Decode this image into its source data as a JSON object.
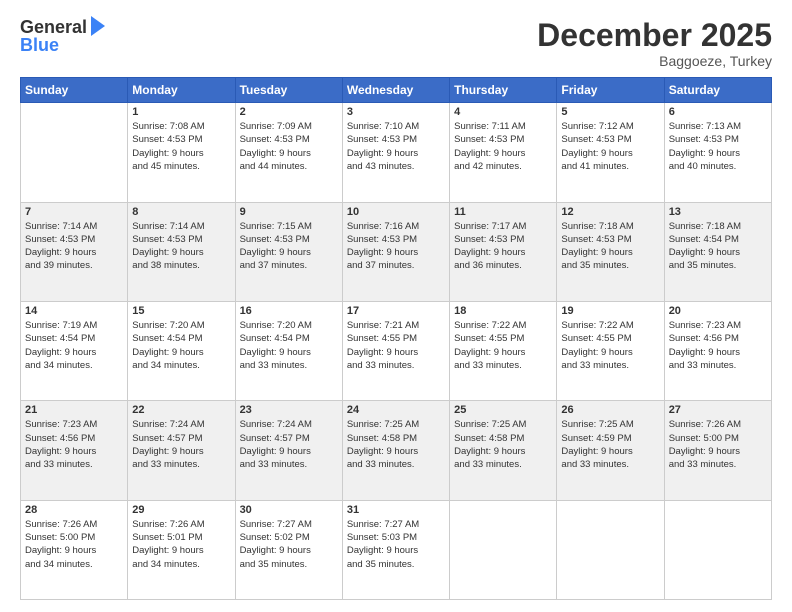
{
  "logo": {
    "general": "General",
    "blue": "Blue"
  },
  "title": "December 2025",
  "subtitle": "Baggoeze, Turkey",
  "days": [
    "Sunday",
    "Monday",
    "Tuesday",
    "Wednesday",
    "Thursday",
    "Friday",
    "Saturday"
  ],
  "rows": [
    [
      {
        "num": "",
        "lines": []
      },
      {
        "num": "1",
        "lines": [
          "Sunrise: 7:08 AM",
          "Sunset: 4:53 PM",
          "Daylight: 9 hours",
          "and 45 minutes."
        ]
      },
      {
        "num": "2",
        "lines": [
          "Sunrise: 7:09 AM",
          "Sunset: 4:53 PM",
          "Daylight: 9 hours",
          "and 44 minutes."
        ]
      },
      {
        "num": "3",
        "lines": [
          "Sunrise: 7:10 AM",
          "Sunset: 4:53 PM",
          "Daylight: 9 hours",
          "and 43 minutes."
        ]
      },
      {
        "num": "4",
        "lines": [
          "Sunrise: 7:11 AM",
          "Sunset: 4:53 PM",
          "Daylight: 9 hours",
          "and 42 minutes."
        ]
      },
      {
        "num": "5",
        "lines": [
          "Sunrise: 7:12 AM",
          "Sunset: 4:53 PM",
          "Daylight: 9 hours",
          "and 41 minutes."
        ]
      },
      {
        "num": "6",
        "lines": [
          "Sunrise: 7:13 AM",
          "Sunset: 4:53 PM",
          "Daylight: 9 hours",
          "and 40 minutes."
        ]
      }
    ],
    [
      {
        "num": "7",
        "lines": [
          "Sunrise: 7:14 AM",
          "Sunset: 4:53 PM",
          "Daylight: 9 hours",
          "and 39 minutes."
        ]
      },
      {
        "num": "8",
        "lines": [
          "Sunrise: 7:14 AM",
          "Sunset: 4:53 PM",
          "Daylight: 9 hours",
          "and 38 minutes."
        ]
      },
      {
        "num": "9",
        "lines": [
          "Sunrise: 7:15 AM",
          "Sunset: 4:53 PM",
          "Daylight: 9 hours",
          "and 37 minutes."
        ]
      },
      {
        "num": "10",
        "lines": [
          "Sunrise: 7:16 AM",
          "Sunset: 4:53 PM",
          "Daylight: 9 hours",
          "and 37 minutes."
        ]
      },
      {
        "num": "11",
        "lines": [
          "Sunrise: 7:17 AM",
          "Sunset: 4:53 PM",
          "Daylight: 9 hours",
          "and 36 minutes."
        ]
      },
      {
        "num": "12",
        "lines": [
          "Sunrise: 7:18 AM",
          "Sunset: 4:53 PM",
          "Daylight: 9 hours",
          "and 35 minutes."
        ]
      },
      {
        "num": "13",
        "lines": [
          "Sunrise: 7:18 AM",
          "Sunset: 4:54 PM",
          "Daylight: 9 hours",
          "and 35 minutes."
        ]
      }
    ],
    [
      {
        "num": "14",
        "lines": [
          "Sunrise: 7:19 AM",
          "Sunset: 4:54 PM",
          "Daylight: 9 hours",
          "and 34 minutes."
        ]
      },
      {
        "num": "15",
        "lines": [
          "Sunrise: 7:20 AM",
          "Sunset: 4:54 PM",
          "Daylight: 9 hours",
          "and 34 minutes."
        ]
      },
      {
        "num": "16",
        "lines": [
          "Sunrise: 7:20 AM",
          "Sunset: 4:54 PM",
          "Daylight: 9 hours",
          "and 33 minutes."
        ]
      },
      {
        "num": "17",
        "lines": [
          "Sunrise: 7:21 AM",
          "Sunset: 4:55 PM",
          "Daylight: 9 hours",
          "and 33 minutes."
        ]
      },
      {
        "num": "18",
        "lines": [
          "Sunrise: 7:22 AM",
          "Sunset: 4:55 PM",
          "Daylight: 9 hours",
          "and 33 minutes."
        ]
      },
      {
        "num": "19",
        "lines": [
          "Sunrise: 7:22 AM",
          "Sunset: 4:55 PM",
          "Daylight: 9 hours",
          "and 33 minutes."
        ]
      },
      {
        "num": "20",
        "lines": [
          "Sunrise: 7:23 AM",
          "Sunset: 4:56 PM",
          "Daylight: 9 hours",
          "and 33 minutes."
        ]
      }
    ],
    [
      {
        "num": "21",
        "lines": [
          "Sunrise: 7:23 AM",
          "Sunset: 4:56 PM",
          "Daylight: 9 hours",
          "and 33 minutes."
        ]
      },
      {
        "num": "22",
        "lines": [
          "Sunrise: 7:24 AM",
          "Sunset: 4:57 PM",
          "Daylight: 9 hours",
          "and 33 minutes."
        ]
      },
      {
        "num": "23",
        "lines": [
          "Sunrise: 7:24 AM",
          "Sunset: 4:57 PM",
          "Daylight: 9 hours",
          "and 33 minutes."
        ]
      },
      {
        "num": "24",
        "lines": [
          "Sunrise: 7:25 AM",
          "Sunset: 4:58 PM",
          "Daylight: 9 hours",
          "and 33 minutes."
        ]
      },
      {
        "num": "25",
        "lines": [
          "Sunrise: 7:25 AM",
          "Sunset: 4:58 PM",
          "Daylight: 9 hours",
          "and 33 minutes."
        ]
      },
      {
        "num": "26",
        "lines": [
          "Sunrise: 7:25 AM",
          "Sunset: 4:59 PM",
          "Daylight: 9 hours",
          "and 33 minutes."
        ]
      },
      {
        "num": "27",
        "lines": [
          "Sunrise: 7:26 AM",
          "Sunset: 5:00 PM",
          "Daylight: 9 hours",
          "and 33 minutes."
        ]
      }
    ],
    [
      {
        "num": "28",
        "lines": [
          "Sunrise: 7:26 AM",
          "Sunset: 5:00 PM",
          "Daylight: 9 hours",
          "and 34 minutes."
        ]
      },
      {
        "num": "29",
        "lines": [
          "Sunrise: 7:26 AM",
          "Sunset: 5:01 PM",
          "Daylight: 9 hours",
          "and 34 minutes."
        ]
      },
      {
        "num": "30",
        "lines": [
          "Sunrise: 7:27 AM",
          "Sunset: 5:02 PM",
          "Daylight: 9 hours",
          "and 35 minutes."
        ]
      },
      {
        "num": "31",
        "lines": [
          "Sunrise: 7:27 AM",
          "Sunset: 5:03 PM",
          "Daylight: 9 hours",
          "and 35 minutes."
        ]
      },
      {
        "num": "",
        "lines": []
      },
      {
        "num": "",
        "lines": []
      },
      {
        "num": "",
        "lines": []
      }
    ]
  ]
}
